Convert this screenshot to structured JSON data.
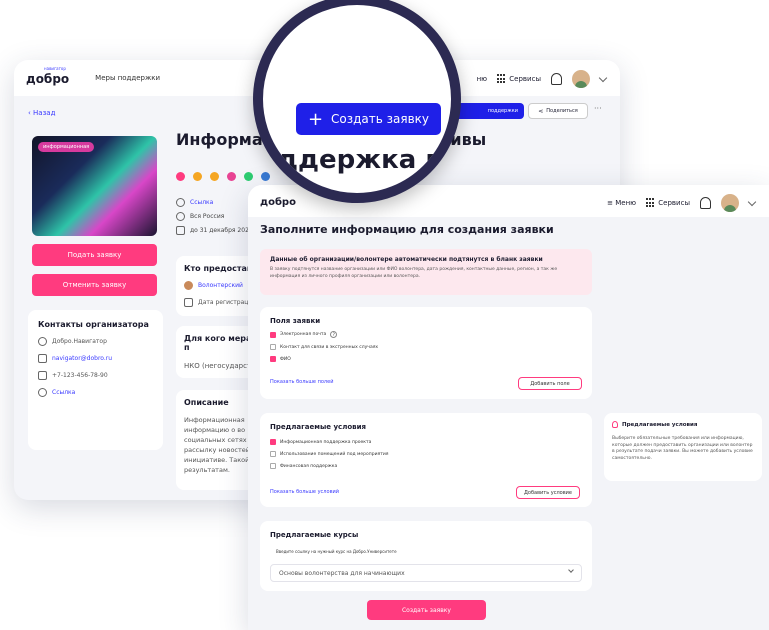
{
  "back": {
    "logo": "добро",
    "logo_sub": "навигатор",
    "nav": "Меры поддержки",
    "menu": "ню",
    "services": "Сервисы",
    "back_link": "‹ Назад",
    "tag": "информационная",
    "title": "Информацио                         альной инициативы",
    "link_label": "Ссылка",
    "region": "Вся Россия",
    "deadline": "до 31 декабря 2023",
    "apply_btn": "Подать заявку",
    "cancel_btn": "Отменить заявку",
    "support_btn": "поддержки",
    "share_btn": "Поделиться",
    "contacts_title": "Контакты организатора",
    "contacts": [
      "Добро.Навигатор",
      "navigator@dobro.ru",
      "+7-123-456-78-90",
      "Ссылка"
    ],
    "provides_title": "Кто предоставл",
    "provider": "Волонтерский",
    "reg_date": "Дата регистрац",
    "for_whom_title": "Для кого мера п",
    "for_whom": "НКО (негосударст",
    "desc_title": "Описание",
    "desc": "Информационная информацию о во социальных сетях рассылку новостей инициативе. Такой и результатам."
  },
  "magnifier": {
    "create_btn": "Создать заявку",
    "zoom_text": "ддержка ваш"
  },
  "front": {
    "logo": "добро",
    "menu": "Меню",
    "services": "Сервисы",
    "title": "Заполните информацию для создания заявки",
    "notice_title": "Данные об организации/волонтере автоматически подтянутся в бланк заявки",
    "notice_text": "В заявку подтянутся название организации или ФИО волонтера, дата рождения, контактные данные, регион, а так же информация из личного профиля организации или волонтера.",
    "fields_title": "Поля заявки",
    "fields": [
      {
        "label": "Электронная почта",
        "on": true
      },
      {
        "label": "Контакт для связи в экстренных случаях",
        "on": false
      },
      {
        "label": "ФИО",
        "on": true
      }
    ],
    "fields_more": "Показать больше полей",
    "add_field": "Добавить поле",
    "cond_title": "Предлагаемые условия",
    "conditions": [
      {
        "label": "Информационная поддержка проекта",
        "on": true
      },
      {
        "label": "Использование помещений под мероприятия",
        "on": false
      },
      {
        "label": "Финансовая поддержка",
        "on": false
      }
    ],
    "cond_more": "Показать больше условий",
    "add_condition": "Добавить условие",
    "courses_title": "Предлагаемые курсы",
    "courses_hint": "Введите ссылку на нужный курс на Добро.Университете",
    "course_value": "Основы волонтерства для начинающих",
    "side_title": "Предлагаемые условия",
    "side_text": "Выберите обязательные требования или информацию, которые должен предоставить организации или волонтер в результате подачи заявки. Вы можете добавить условие самостоятельно.",
    "submit": "Создать заявку"
  }
}
